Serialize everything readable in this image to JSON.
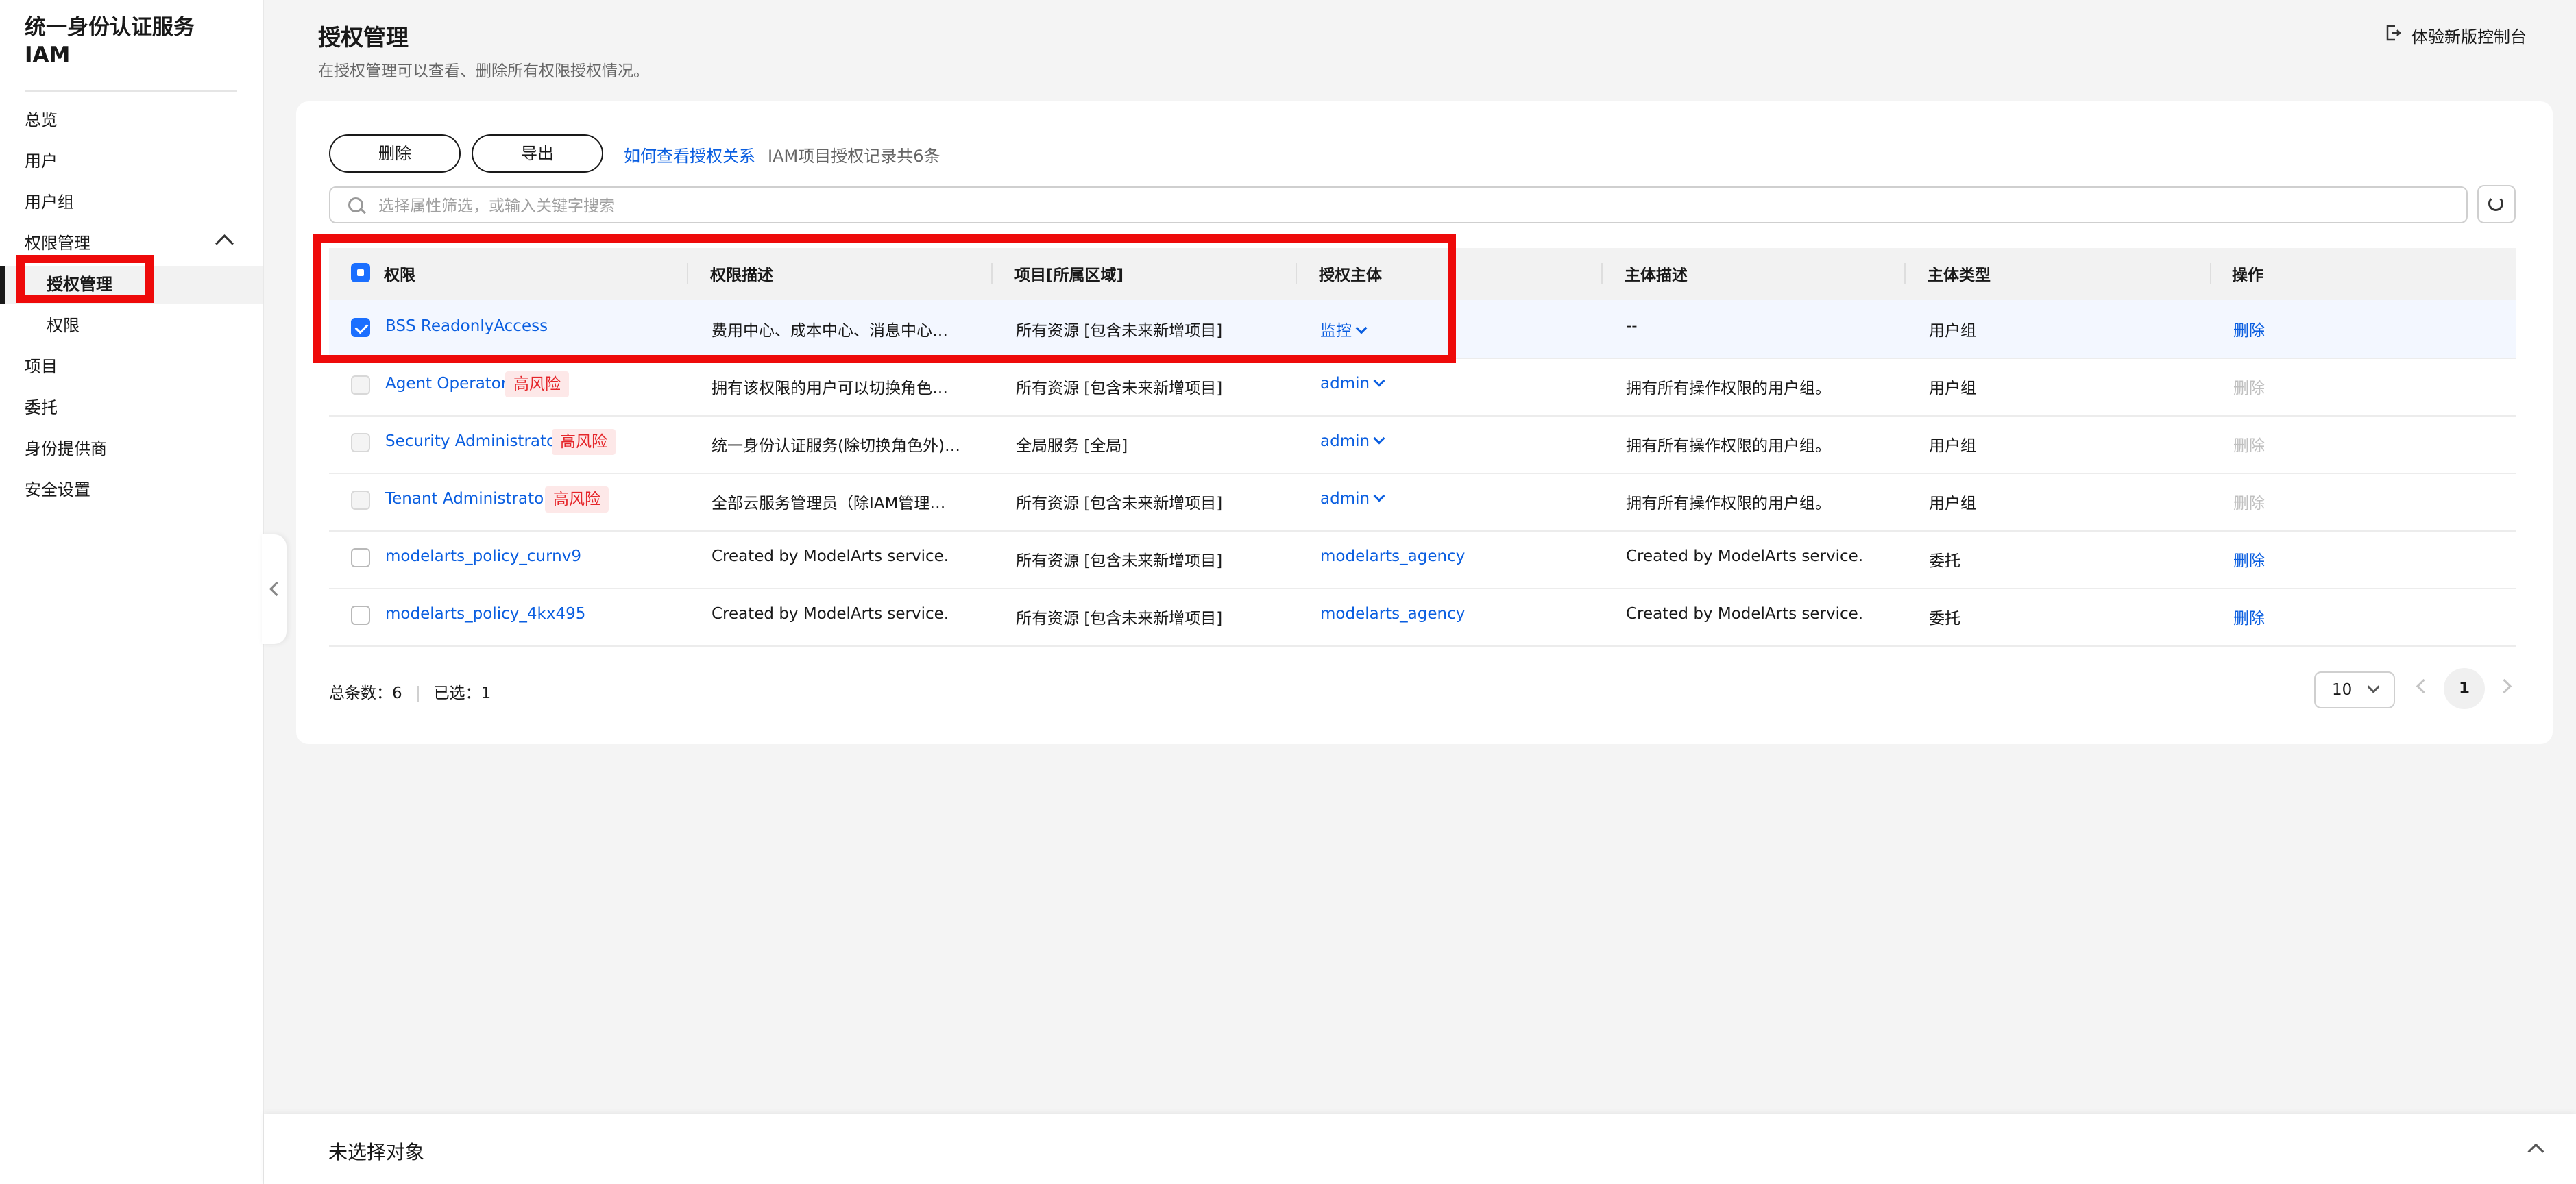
{
  "sidebar": {
    "brand_line1": "统一身份认证服务",
    "brand_line2": "IAM",
    "items": [
      {
        "label": "总览"
      },
      {
        "label": "用户"
      },
      {
        "label": "用户组"
      },
      {
        "label": "权限管理"
      },
      {
        "label": "授权管理"
      },
      {
        "label": "权限"
      },
      {
        "label": "项目"
      },
      {
        "label": "委托"
      },
      {
        "label": "身份提供商"
      },
      {
        "label": "安全设置"
      }
    ]
  },
  "header": {
    "title": "授权管理",
    "description": "在授权管理可以查看、删除所有权限授权情况。",
    "new_console": "体验新版控制台"
  },
  "toolbar": {
    "delete_label": "删除",
    "export_label": "导出",
    "help_link": "如何查看授权关系",
    "record_note": "IAM项目授权记录共6条"
  },
  "search": {
    "placeholder": "选择属性筛选，或输入关键字搜索",
    "value": ""
  },
  "table": {
    "columns": [
      "权限",
      "权限描述",
      "项目[所属区域]",
      "授权主体",
      "主体描述",
      "主体类型",
      "操作"
    ],
    "rows": [
      {
        "policy": "BSS ReadonlyAccess",
        "risk": "",
        "policy_desc": "费用中心、成本中心、消息中心…",
        "project": "所有资源 [包含未来新增项目]",
        "principal": "监控",
        "principal_desc": "--",
        "principal_type": "用户组",
        "action": "删除"
      },
      {
        "policy": "Agent Operator",
        "risk": "高风险",
        "policy_desc": "拥有该权限的用户可以切换角色…",
        "project": "所有资源 [包含未来新增项目]",
        "principal": "admin",
        "principal_desc": "拥有所有操作权限的用户组。",
        "principal_type": "用户组",
        "action": "删除"
      },
      {
        "policy": "Security Administrator",
        "risk": "高风险",
        "policy_desc": "统一身份认证服务(除切换角色外)…",
        "project": "全局服务 [全局]",
        "principal": "admin",
        "principal_desc": "拥有所有操作权限的用户组。",
        "principal_type": "用户组",
        "action": "删除"
      },
      {
        "policy": "Tenant Administrator",
        "risk": "高风险",
        "policy_desc": "全部云服务管理员（除IAM管理…",
        "project": "所有资源 [包含未来新增项目]",
        "principal": "admin",
        "principal_desc": "拥有所有操作权限的用户组。",
        "principal_type": "用户组",
        "action": "删除"
      },
      {
        "policy": "modelarts_policy_curnv9",
        "risk": "",
        "policy_desc": "Created by ModelArts service.",
        "project": "所有资源 [包含未来新增项目]",
        "principal": "modelarts_agency",
        "principal_desc": "Created by ModelArts service.",
        "principal_type": "委托",
        "action": "删除"
      },
      {
        "policy": "modelarts_policy_4kx495",
        "risk": "",
        "policy_desc": "Created by ModelArts service.",
        "project": "所有资源 [包含未来新增项目]",
        "principal": "modelarts_agency",
        "principal_desc": "Created by ModelArts service.",
        "principal_type": "委托",
        "action": "删除"
      }
    ]
  },
  "footer": {
    "total_label": "总条数：6",
    "selected_label": "已选：1",
    "page_size": "10",
    "current_page": "1"
  },
  "bottom_bar": {
    "label": "未选择对象"
  },
  "colors": {
    "link": "#0a5ee0",
    "highlight": "#ee0a0a",
    "risk_text": "#e5262a",
    "risk_bg": "#fde8e8",
    "checkbox_checked": "#1b6fff"
  }
}
